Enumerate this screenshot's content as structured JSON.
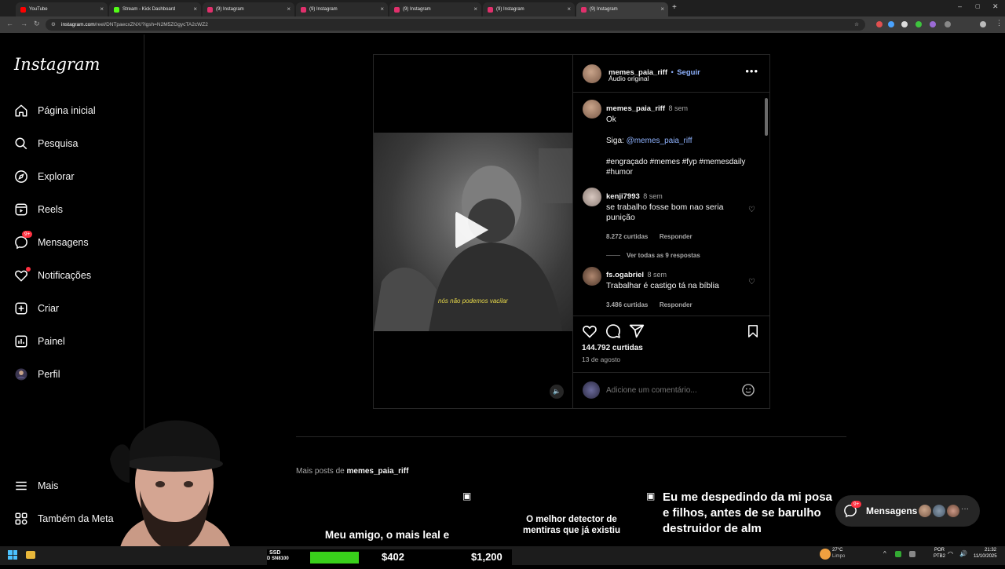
{
  "browser": {
    "tabs": [
      {
        "title": "YouTube",
        "color": "#ff0000",
        "active": false
      },
      {
        "title": "Stream - Kick Dashboard",
        "color": "#53fc18",
        "active": false
      },
      {
        "title": "(9) Instagram",
        "color": "#e1306c",
        "active": false
      },
      {
        "title": "(9) Instagram",
        "color": "#e1306c",
        "active": false
      },
      {
        "title": "(9) Instagram",
        "color": "#e1306c",
        "active": false
      },
      {
        "title": "(9) Instagram",
        "color": "#e1306c",
        "active": false
      },
      {
        "title": "(9) Instagram",
        "color": "#e1306c",
        "active": true
      }
    ],
    "url_host": "instagram.com",
    "url_path": "/reel/DNTpaecxZNX/?igsh=N2M5ZGgycTA2cWZ2"
  },
  "sidebar": {
    "logo": "Instagram",
    "items": [
      {
        "label": "Página inicial",
        "icon": "home-icon"
      },
      {
        "label": "Pesquisa",
        "icon": "search-icon"
      },
      {
        "label": "Explorar",
        "icon": "compass-icon"
      },
      {
        "label": "Reels",
        "icon": "reels-icon"
      },
      {
        "label": "Mensagens",
        "icon": "messenger-icon",
        "badge": "9+"
      },
      {
        "label": "Notificações",
        "icon": "heart-icon",
        "dot": true
      },
      {
        "label": "Criar",
        "icon": "plus-square-icon"
      },
      {
        "label": "Painel",
        "icon": "chart-icon"
      },
      {
        "label": "Perfil",
        "icon": "avatar-icon"
      }
    ],
    "more": "Mais",
    "meta": "Também da Meta"
  },
  "post": {
    "subtitle": "nós não podemos vacilar",
    "header": {
      "username": "memes_paia_riff",
      "separator": "•",
      "follow": "Seguir",
      "audio": "Áudio original"
    },
    "caption": {
      "username": "memes_paia_riff",
      "time": "8 sem",
      "line1": "Ok",
      "follow_prefix": "Siga:",
      "follow_handle": "@memes_paia_riff",
      "hashtags1": "#engraçado #memes #fyp #memesdaily",
      "hashtags2": "#humor"
    },
    "comments": [
      {
        "username": "kenji7993",
        "time": "8 sem",
        "text": "se trabalho fosse bom nao seria punição",
        "likes": "8.272 curtidas",
        "reply": "Responder",
        "view_replies": "Ver todas as 9 respostas"
      },
      {
        "username": "fs.ogabriel",
        "time": "8 sem",
        "text": "Trabalhar é castigo tá na bíblia",
        "likes": "3.486 curtidas",
        "reply": "Responder"
      }
    ],
    "likes": "144.792 curtidas",
    "date": "13 de agosto",
    "comment_placeholder": "Adicione um comentário..."
  },
  "more_posts": {
    "prefix": "Mais posts de",
    "username": "memes_paia_riff",
    "thumbs": [
      {
        "text": "Meu amigo, o mais leal e"
      },
      {
        "text": "O melhor detector de mentiras que já existiu"
      },
      {
        "text": "Eu me despedindo da mi posa e filhos, antes de se barulho destruidor de alm"
      }
    ]
  },
  "messages_pill": {
    "label": "Mensagens",
    "badge": "9+"
  },
  "stream_overlay": {
    "ssd_label": "SSD",
    "ssd_sub": "D SN8100",
    "price1": "$402",
    "price2": "$1,200"
  },
  "taskbar": {
    "temp": "27°C",
    "weather": "Limpo",
    "lang1": "POR",
    "lang2": "PTB2",
    "time": "21:32",
    "date": "11/10/2025"
  }
}
